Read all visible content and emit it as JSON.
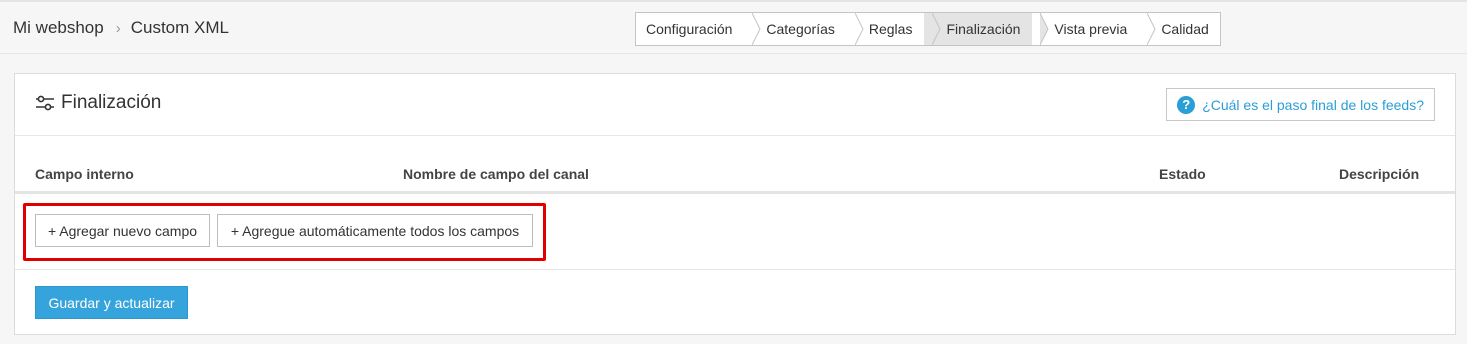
{
  "breadcrumb": {
    "shop": "Mi webshop",
    "separator": "›",
    "current": "Custom XML"
  },
  "steps": [
    {
      "label": "Configuración",
      "active": false
    },
    {
      "label": "Categorías",
      "active": false
    },
    {
      "label": "Reglas",
      "active": false
    },
    {
      "label": "Finalización",
      "active": true
    },
    {
      "label": "Vista previa",
      "active": false
    },
    {
      "label": "Calidad",
      "active": false
    }
  ],
  "panel": {
    "title": "Finalización",
    "title_icon": "sliders-icon",
    "help_icon": "question-circle-icon",
    "help_label": "¿Cuál es el paso final de los feeds?"
  },
  "table": {
    "headers": [
      "Campo interno",
      "Nombre de campo del canal",
      "Estado",
      "Descripción"
    ]
  },
  "actions": {
    "add_field": "+ Agregar nuevo campo",
    "add_all": "+ Agregue automáticamente todos los campos",
    "save": "Guardar y actualizar"
  },
  "colors": {
    "accent": "#35a3dc",
    "link": "#2a9fd6",
    "highlight": "#e00000",
    "active_step": "#e4e4e4"
  }
}
